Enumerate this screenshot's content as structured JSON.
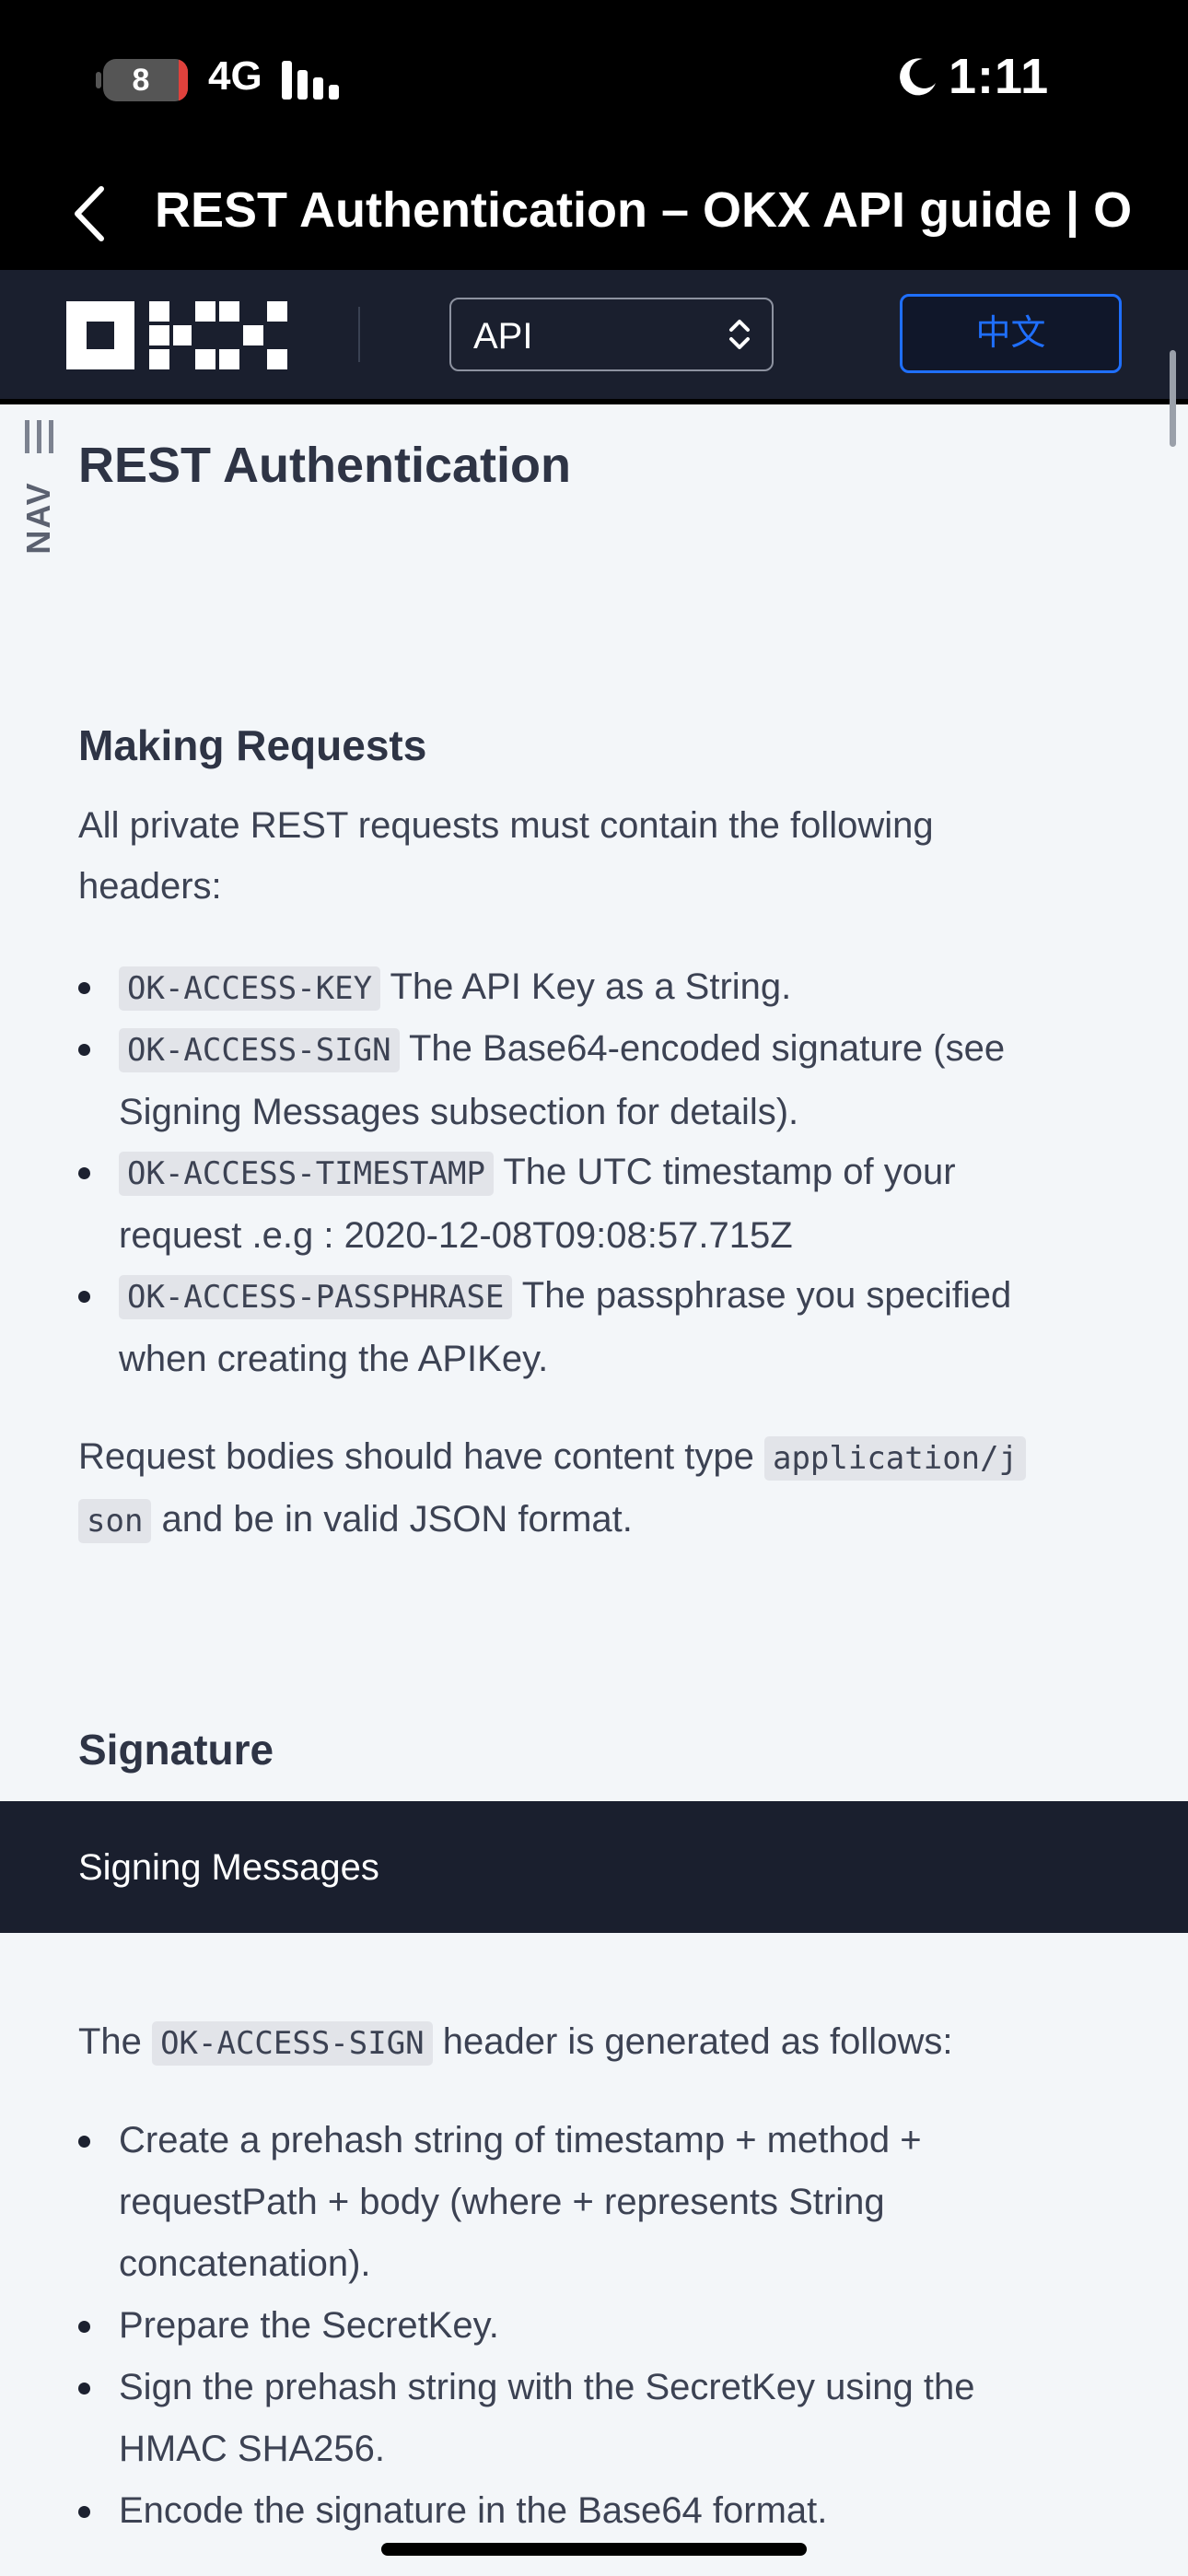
{
  "status_bar": {
    "battery_level": "8",
    "network": "4G",
    "time": "1:11",
    "icons": [
      "battery-icon",
      "signal-bars-icon",
      "do-not-disturb-moon-icon"
    ]
  },
  "browser": {
    "page_title": "REST Authentication – OKX API guide | O..."
  },
  "site_header": {
    "logo_alt": "OKX",
    "api_select_value": "API",
    "lang_button": "中文",
    "colors": {
      "header_bg": "#1a1f2e",
      "accent": "#1f6fff"
    }
  },
  "nav_toggle": {
    "label": "NAV"
  },
  "content": {
    "title": "REST Authentication",
    "making_requests": {
      "heading": "Making Requests",
      "intro_line1": "All private REST requests must contain the following",
      "intro_line2": "headers:",
      "headers": [
        {
          "code": "OK-ACCESS-KEY",
          "line1": "The API Key as a String."
        },
        {
          "code": "OK-ACCESS-SIGN",
          "line1": "The Base64-encoded signature (see",
          "line2": "Signing Messages subsection for details)."
        },
        {
          "code": "OK-ACCESS-TIMESTAMP",
          "line1": "The UTC timestamp of your",
          "line2": "request .e.g : 2020-12-08T09:08:57.715Z"
        },
        {
          "code": "OK-ACCESS-PASSPHRASE",
          "line1": "The passphrase you specified",
          "line2": "when creating the APIKey."
        }
      ],
      "body_note_pre": "Request bodies should have content type",
      "body_note_code_a": "application/j",
      "body_note_code_b": "son",
      "body_note_post": "and be in valid JSON format."
    },
    "signature": {
      "heading": "Signature",
      "bar_label": "Signing Messages",
      "intro_pre": "The",
      "intro_code": "OK-ACCESS-SIGN",
      "intro_post": "header is generated as follows:",
      "steps": [
        {
          "line1": "Create a prehash string of timestamp + method +",
          "line2": "requestPath + body (where + represents String",
          "line3": "concatenation)."
        },
        {
          "line1": "Prepare the SecretKey."
        },
        {
          "line1": "Sign the prehash string with the SecretKey using the",
          "line2": "HMAC SHA256."
        },
        {
          "line1": "Encode the signature in the Base64 format."
        }
      ]
    }
  }
}
